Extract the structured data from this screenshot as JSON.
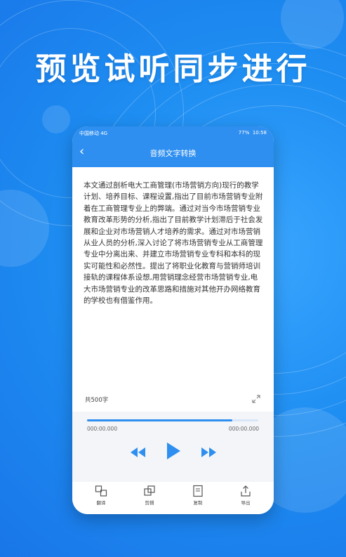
{
  "headline": "预览试听同步进行",
  "status": {
    "carrier": "中国移动 4G",
    "battery": "77%",
    "time": "10:58"
  },
  "titlebar": {
    "title": "音频文字转换"
  },
  "content": {
    "paragraph": "本文通过剖析电大工商管理(市场营销方向)现行的教学计划、培养目标、课程设置,指出了目前市场营销专业附着在工商管理专业上的弊端。通过对当今市场营销专业教育改革形势的分析,指出了目前教学计划滞后于社会发展和企业对市场营销人才培养的需求。通过对市场营销从业人员的分析,深入讨论了将市场营销专业从工商管理专业中分离出来、并建立市场营销专业专科和本科的现实可能性和必然性。提出了将职业化教育与营销师培训接轨的课程体系设想,用营销理念经营市场营销专业,电大市场营销专业的改革思路和措施对其他开办网络教育的学校也有借鉴作用。",
    "word_count": "共500字"
  },
  "player": {
    "current_time": "000:00.000",
    "total_time": "000:00.000",
    "progress": 0.85
  },
  "tabs": [
    {
      "label": "翻译",
      "icon": "translate-icon"
    },
    {
      "label": "剪辑",
      "icon": "clip-icon"
    },
    {
      "label": "复制",
      "icon": "copy-icon"
    },
    {
      "label": "导出",
      "icon": "export-icon"
    }
  ],
  "colors": {
    "accent": "#2e8ff0",
    "background": "#1f8cf0"
  }
}
